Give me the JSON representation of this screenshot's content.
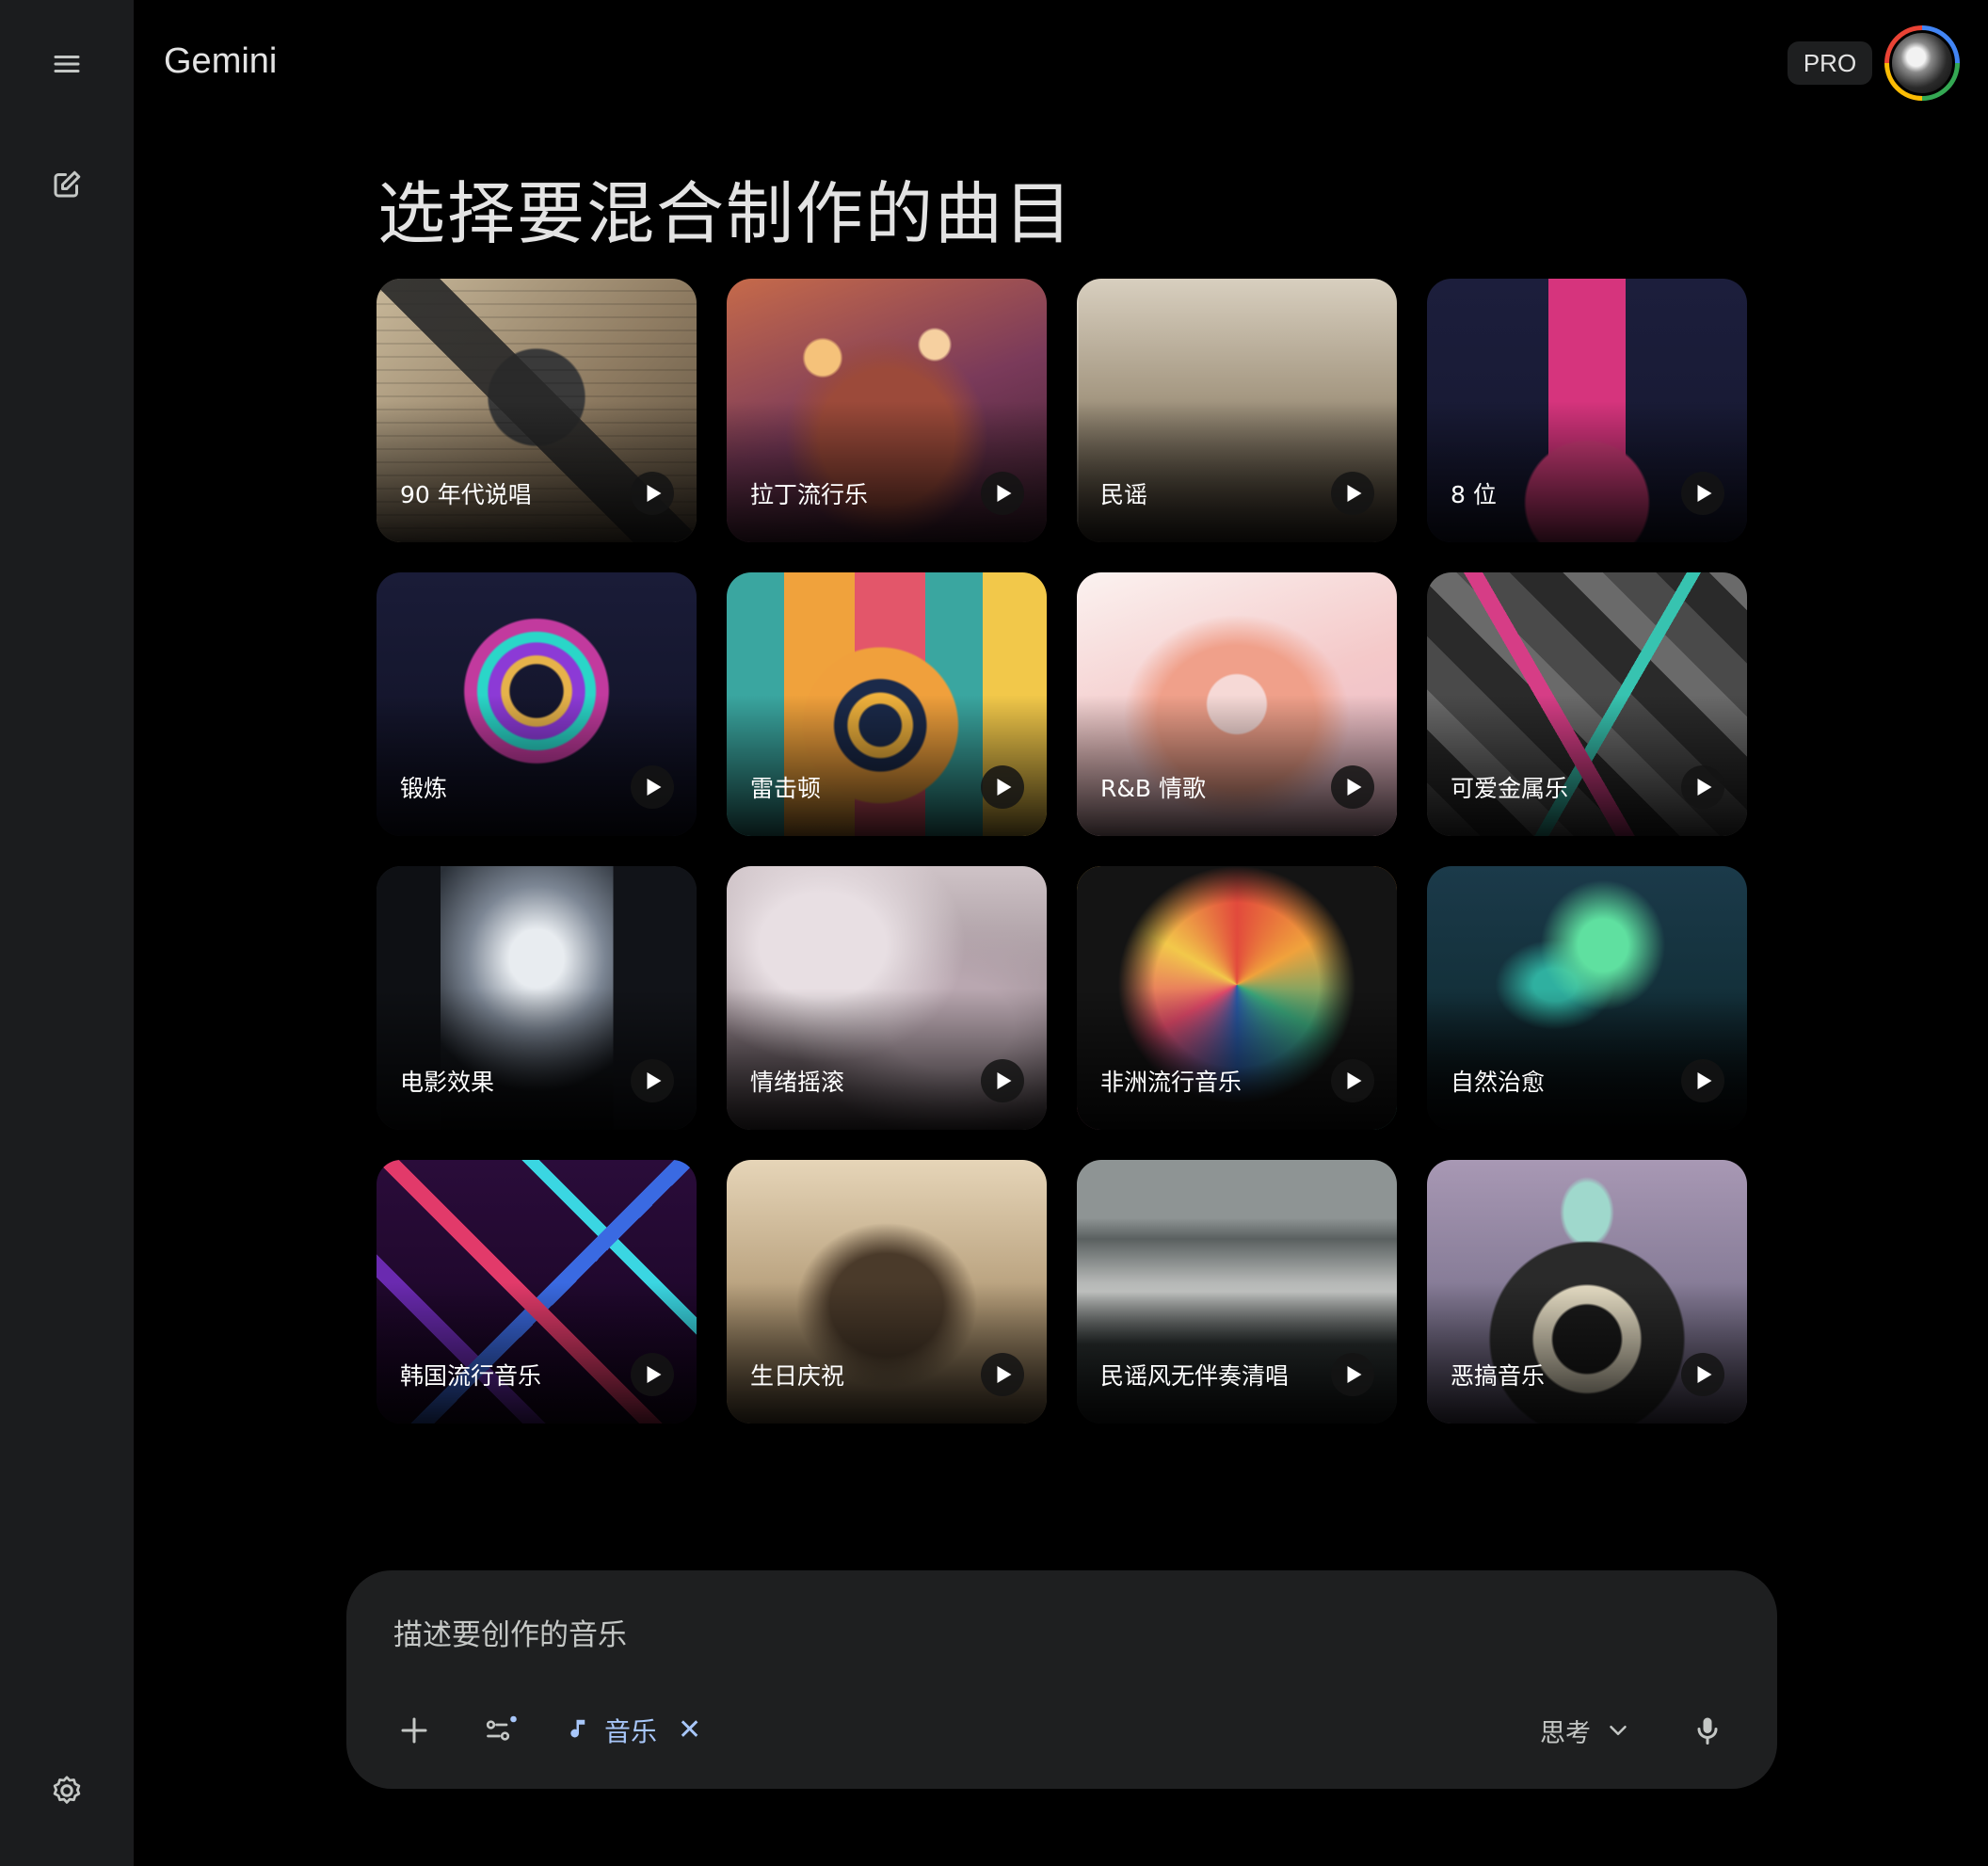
{
  "app": {
    "name": "Gemini",
    "plan_badge": "PRO"
  },
  "colors": {
    "background": "#000000",
    "sidebar": "#1b1c1e",
    "surface": "#1e1f20",
    "accent": "#a8c7fa"
  },
  "icons": {
    "menu": "menu-icon",
    "new_chat": "edit-icon",
    "settings": "gear-icon",
    "play": "play-icon",
    "add": "plus-icon",
    "tools": "tools-icon",
    "music": "music-note-icon",
    "close": "close-icon",
    "chevron": "chevron-down-icon",
    "mic": "mic-icon"
  },
  "main": {
    "title": "选择要混合制作的曲目",
    "tracks": [
      {
        "label": "90 年代说唱"
      },
      {
        "label": "拉丁流行乐"
      },
      {
        "label": "民谣"
      },
      {
        "label": "8 位"
      },
      {
        "label": "锻炼"
      },
      {
        "label": "雷击顿"
      },
      {
        "label": "R&B 情歌"
      },
      {
        "label": "可爱金属乐"
      },
      {
        "label": "电影效果"
      },
      {
        "label": "情绪摇滚"
      },
      {
        "label": "非洲流行音乐"
      },
      {
        "label": "自然治愈"
      },
      {
        "label": "韩国流行音乐"
      },
      {
        "label": "生日庆祝"
      },
      {
        "label": "民谣风无伴奏清唱"
      },
      {
        "label": "恶搞音乐"
      }
    ]
  },
  "composer": {
    "placeholder": "描述要创作的音乐",
    "chip_label": "音乐",
    "chip_close": "✕",
    "mode_label": "思考"
  }
}
